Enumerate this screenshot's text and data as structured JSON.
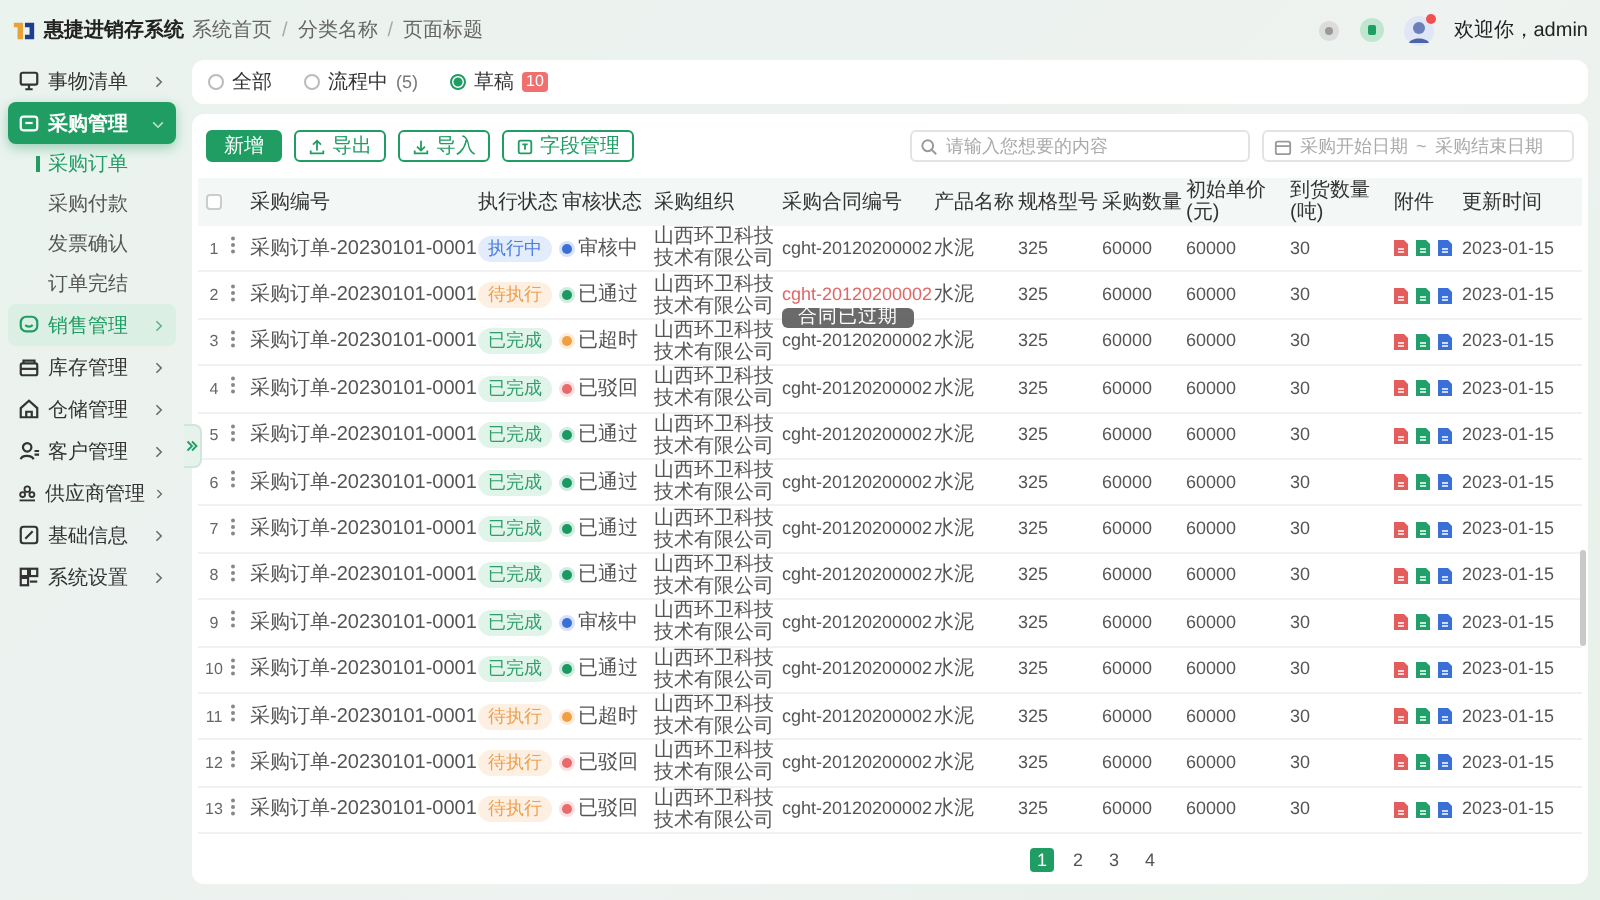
{
  "app": {
    "title": "惠捷进销存系统"
  },
  "sidebar": {
    "items": [
      {
        "label": "事物清单",
        "selected": false,
        "expanded": false,
        "highlighted": false
      },
      {
        "label": "采购管理",
        "selected": true,
        "expanded": true,
        "highlighted": false,
        "children": [
          {
            "label": "采购订单",
            "selected": true
          },
          {
            "label": "采购付款",
            "selected": false
          },
          {
            "label": "发票确认",
            "selected": false
          },
          {
            "label": "订单完结",
            "selected": false
          }
        ]
      },
      {
        "label": "销售管理",
        "selected": false,
        "expanded": false,
        "highlighted": true
      },
      {
        "label": "库存管理",
        "selected": false,
        "expanded": false,
        "highlighted": false
      },
      {
        "label": "仓储管理",
        "selected": false,
        "expanded": false,
        "highlighted": false
      },
      {
        "label": "客户管理",
        "selected": false,
        "expanded": false,
        "highlighted": false
      },
      {
        "label": "供应商管理",
        "selected": false,
        "expanded": false,
        "highlighted": false
      },
      {
        "label": "基础信息",
        "selected": false,
        "expanded": false,
        "highlighted": false
      },
      {
        "label": "系统设置",
        "selected": false,
        "expanded": false,
        "highlighted": false
      }
    ]
  },
  "breadcrumb": {
    "items": [
      "系统首页",
      "分类名称",
      "页面标题"
    ],
    "separator": "/"
  },
  "user": {
    "greeting": "欢迎你，admin",
    "notification": true
  },
  "filter": {
    "options": [
      {
        "label": "全部",
        "selected": false
      },
      {
        "label": "流程中",
        "count": "(5)",
        "selected": false
      },
      {
        "label": "草稿",
        "badge": "10",
        "selected": true
      }
    ]
  },
  "toolbar": {
    "buttons": [
      {
        "label": "新增",
        "kind": "primary"
      },
      {
        "label": "导出",
        "kind": "export"
      },
      {
        "label": "导入",
        "kind": "import"
      },
      {
        "label": "字段管理",
        "kind": "fields"
      }
    ],
    "search": {
      "placeholder": "请输入您想要的内容"
    },
    "date_range": {
      "start_placeholder": "采购开始日期",
      "separator": "~",
      "end_placeholder": "采购结束日期"
    }
  },
  "table": {
    "select_all": {
      "checked": false
    },
    "columns": [
      "采购编号",
      "执行状态",
      "审核状态",
      "采购组织",
      "采购合同编号",
      "产品名称",
      "规格型号",
      "采购数量",
      "初始单价(元)",
      "到货数量(吨)",
      "附件",
      "更新时间"
    ],
    "rows": [
      {
        "index": "1",
        "code": "采购订单-20230101-0001",
        "exec": {
          "text": "执行中",
          "kind": "running"
        },
        "audit": {
          "text": "审核中",
          "kind": "reviewing"
        },
        "org": "山西环卫科技技术有限公司",
        "contract": {
          "text": "cght-20120200002",
          "expired": false
        },
        "product": "水泥",
        "spec": "325",
        "qty": "60000",
        "price": "60000",
        "arrived": "30",
        "updated": "2023-01-15"
      },
      {
        "index": "2",
        "code": "采购订单-20230101-0001",
        "exec": {
          "text": "待执行",
          "kind": "pending"
        },
        "audit": {
          "text": "已通过",
          "kind": "passed"
        },
        "org": "山西环卫科技技术有限公司",
        "contract": {
          "text": "cght-20120200002",
          "expired": true,
          "tooltip": "合同已过期"
        },
        "product": "水泥",
        "spec": "325",
        "qty": "60000",
        "price": "60000",
        "arrived": "30",
        "updated": "2023-01-15"
      },
      {
        "index": "3",
        "code": "采购订单-20230101-0001",
        "exec": {
          "text": "已完成",
          "kind": "done"
        },
        "audit": {
          "text": "已超时",
          "kind": "timeout"
        },
        "org": "山西环卫科技技术有限公司",
        "contract": {
          "text": "cght-20120200002",
          "expired": false
        },
        "product": "水泥",
        "spec": "325",
        "qty": "60000",
        "price": "60000",
        "arrived": "30",
        "updated": "2023-01-15"
      },
      {
        "index": "4",
        "code": "采购订单-20230101-0001",
        "exec": {
          "text": "已完成",
          "kind": "done"
        },
        "audit": {
          "text": "已驳回",
          "kind": "rejected"
        },
        "org": "山西环卫科技技术有限公司",
        "contract": {
          "text": "cght-20120200002",
          "expired": false
        },
        "product": "水泥",
        "spec": "325",
        "qty": "60000",
        "price": "60000",
        "arrived": "30",
        "updated": "2023-01-15"
      },
      {
        "index": "5",
        "code": "采购订单-20230101-0001",
        "exec": {
          "text": "已完成",
          "kind": "done"
        },
        "audit": {
          "text": "已通过",
          "kind": "passed"
        },
        "org": "山西环卫科技技术有限公司",
        "contract": {
          "text": "cght-20120200002",
          "expired": false
        },
        "product": "水泥",
        "spec": "325",
        "qty": "60000",
        "price": "60000",
        "arrived": "30",
        "updated": "2023-01-15"
      },
      {
        "index": "6",
        "code": "采购订单-20230101-0001",
        "exec": {
          "text": "已完成",
          "kind": "done"
        },
        "audit": {
          "text": "已通过",
          "kind": "passed"
        },
        "org": "山西环卫科技技术有限公司",
        "contract": {
          "text": "cght-20120200002",
          "expired": false
        },
        "product": "水泥",
        "spec": "325",
        "qty": "60000",
        "price": "60000",
        "arrived": "30",
        "updated": "2023-01-15"
      },
      {
        "index": "7",
        "code": "采购订单-20230101-0001",
        "exec": {
          "text": "已完成",
          "kind": "done"
        },
        "audit": {
          "text": "已通过",
          "kind": "passed"
        },
        "org": "山西环卫科技技术有限公司",
        "contract": {
          "text": "cght-20120200002",
          "expired": false
        },
        "product": "水泥",
        "spec": "325",
        "qty": "60000",
        "price": "60000",
        "arrived": "30",
        "updated": "2023-01-15"
      },
      {
        "index": "8",
        "code": "采购订单-20230101-0001",
        "exec": {
          "text": "已完成",
          "kind": "done"
        },
        "audit": {
          "text": "已通过",
          "kind": "passed"
        },
        "org": "山西环卫科技技术有限公司",
        "contract": {
          "text": "cght-20120200002",
          "expired": false
        },
        "product": "水泥",
        "spec": "325",
        "qty": "60000",
        "price": "60000",
        "arrived": "30",
        "updated": "2023-01-15"
      },
      {
        "index": "9",
        "code": "采购订单-20230101-0001",
        "exec": {
          "text": "已完成",
          "kind": "done"
        },
        "audit": {
          "text": "审核中",
          "kind": "reviewing"
        },
        "org": "山西环卫科技技术有限公司",
        "contract": {
          "text": "cght-20120200002",
          "expired": false
        },
        "product": "水泥",
        "spec": "325",
        "qty": "60000",
        "price": "60000",
        "arrived": "30",
        "updated": "2023-01-15"
      },
      {
        "index": "10",
        "code": "采购订单-20230101-0001",
        "exec": {
          "text": "已完成",
          "kind": "done"
        },
        "audit": {
          "text": "已通过",
          "kind": "passed"
        },
        "org": "山西环卫科技技术有限公司",
        "contract": {
          "text": "cght-20120200002",
          "expired": false
        },
        "product": "水泥",
        "spec": "325",
        "qty": "60000",
        "price": "60000",
        "arrived": "30",
        "updated": "2023-01-15"
      },
      {
        "index": "11",
        "code": "采购订单-20230101-0001",
        "exec": {
          "text": "待执行",
          "kind": "pending"
        },
        "audit": {
          "text": "已超时",
          "kind": "timeout"
        },
        "org": "山西环卫科技技术有限公司",
        "contract": {
          "text": "cght-20120200002",
          "expired": false
        },
        "product": "水泥",
        "spec": "325",
        "qty": "60000",
        "price": "60000",
        "arrived": "30",
        "updated": "2023-01-15"
      },
      {
        "index": "12",
        "code": "采购订单-20230101-0001",
        "exec": {
          "text": "待执行",
          "kind": "pending"
        },
        "audit": {
          "text": "已驳回",
          "kind": "rejected"
        },
        "org": "山西环卫科技技术有限公司",
        "contract": {
          "text": "cght-20120200002",
          "expired": false
        },
        "product": "水泥",
        "spec": "325",
        "qty": "60000",
        "price": "60000",
        "arrived": "30",
        "updated": "2023-01-15"
      },
      {
        "index": "13",
        "code": "采购订单-20230101-0001",
        "exec": {
          "text": "待执行",
          "kind": "pending"
        },
        "audit": {
          "text": "已驳回",
          "kind": "rejected"
        },
        "org": "山西环卫科技技术有限公司",
        "contract": {
          "text": "cght-20120200002",
          "expired": false
        },
        "product": "水泥",
        "spec": "325",
        "qty": "60000",
        "price": "60000",
        "arrived": "30",
        "updated": "2023-01-15"
      }
    ]
  },
  "pagination": {
    "pages": [
      {
        "label": "1",
        "selected": true
      },
      {
        "label": "2",
        "selected": false
      },
      {
        "label": "3",
        "selected": false
      },
      {
        "label": "4",
        "selected": false
      }
    ]
  }
}
